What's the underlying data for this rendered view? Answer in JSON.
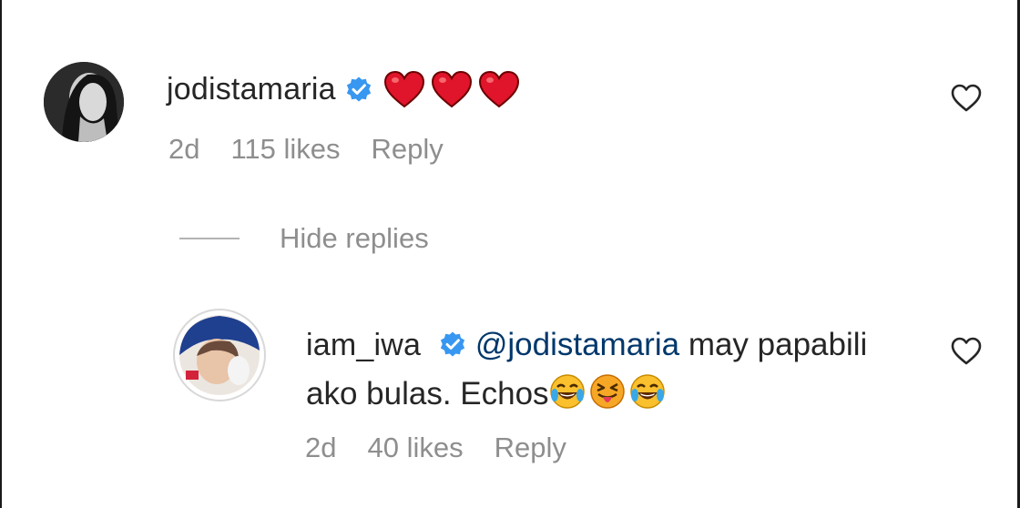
{
  "comment": {
    "username": "jodistamaria",
    "verified_icon": "verified-badge-icon",
    "text_icons": [
      "red-heart-icon",
      "red-heart-icon",
      "red-heart-icon"
    ],
    "time": "2d",
    "likes": "115 likes",
    "reply_label": "Reply",
    "like_icon": "heart-outline-icon"
  },
  "hide_replies_label": "Hide replies",
  "reply": {
    "username": "iam_iwa",
    "verified_icon": "verified-badge-icon",
    "mention": "@jodistamaria",
    "text_part1": "may papabili ako bulas. Echos",
    "text_icons": [
      "tears-of-joy-emoji-icon",
      "squinting-tongue-emoji-icon",
      "tears-of-joy-emoji-icon"
    ],
    "time": "2d",
    "likes": "40 likes",
    "reply_label": "Reply",
    "like_icon": "heart-outline-icon"
  },
  "colors": {
    "text_primary": "#262626",
    "text_secondary": "#8e8e8e",
    "verified_blue": "#3897f0",
    "mention_blue": "#00376b",
    "heart_red": "#e0142a"
  }
}
